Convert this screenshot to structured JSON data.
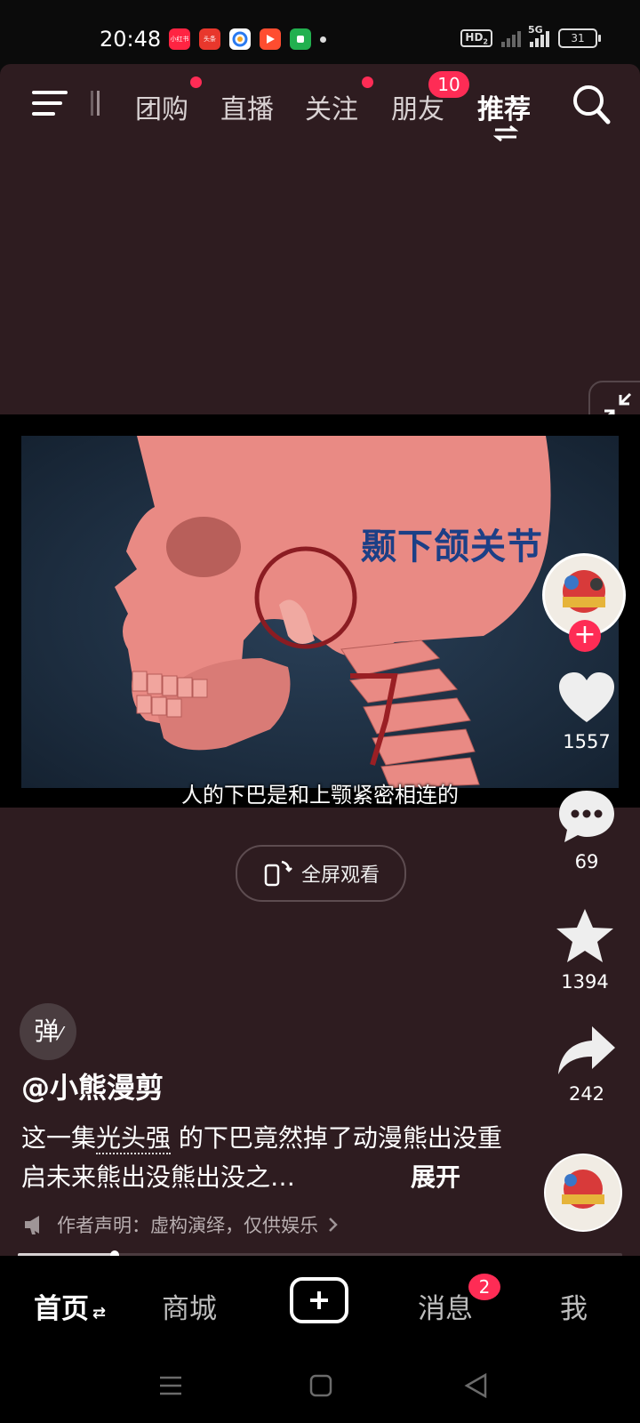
{
  "status_bar": {
    "time": "20:48",
    "network": "HD",
    "network_sub": "2",
    "cell_label": "5G",
    "battery": "31",
    "apps": [
      {
        "icon": "xiaohongshu-icon",
        "label": "小红书",
        "color": "#ff2442"
      },
      {
        "icon": "toutiao-icon",
        "label": "头条",
        "color": "#e8372c"
      },
      {
        "icon": "browser-icon",
        "label": "",
        "color": "#ffffff"
      },
      {
        "icon": "video-app-icon",
        "label": "",
        "color": "#ff4d30"
      },
      {
        "icon": "green-app-icon",
        "label": "",
        "color": "#22b04f"
      }
    ]
  },
  "top_nav": {
    "tabs": [
      {
        "label": "团购",
        "dot": true
      },
      {
        "label": "直播",
        "dot": false
      },
      {
        "label": "关注",
        "dot": true
      },
      {
        "label": "朋友",
        "badge": "10"
      },
      {
        "label": "推荐",
        "active": true
      }
    ]
  },
  "video": {
    "overlay_text": "颞下颌关节",
    "subtitle": "人的下巴是和上颚紧密相连的",
    "fullscreen_label": "全屏观看"
  },
  "actions": {
    "likes": "1557",
    "comments": "69",
    "favorites": "1394",
    "shares": "242"
  },
  "post": {
    "danmaku_label": "弹",
    "author": "@小熊漫剪",
    "desc_prefix": "这一集",
    "desc_keyword": "光头强",
    "desc_rest": " 的下巴竟然掉了动漫熊出没重启未来熊出没熊出没之…",
    "expand_label": "展开",
    "notice": "作者声明：虚构演绎，仅供娱乐"
  },
  "progress": {
    "fraction": 0.16
  },
  "tab_bar": {
    "tabs": [
      {
        "label": "首页",
        "active": true
      },
      {
        "label": "商城"
      },
      {
        "label": "消息",
        "badge": "2"
      },
      {
        "label": "我"
      }
    ]
  },
  "colors": {
    "accent": "#fe2c55",
    "panel_bg": "#2e1c20",
    "skull": "#e98a84"
  }
}
